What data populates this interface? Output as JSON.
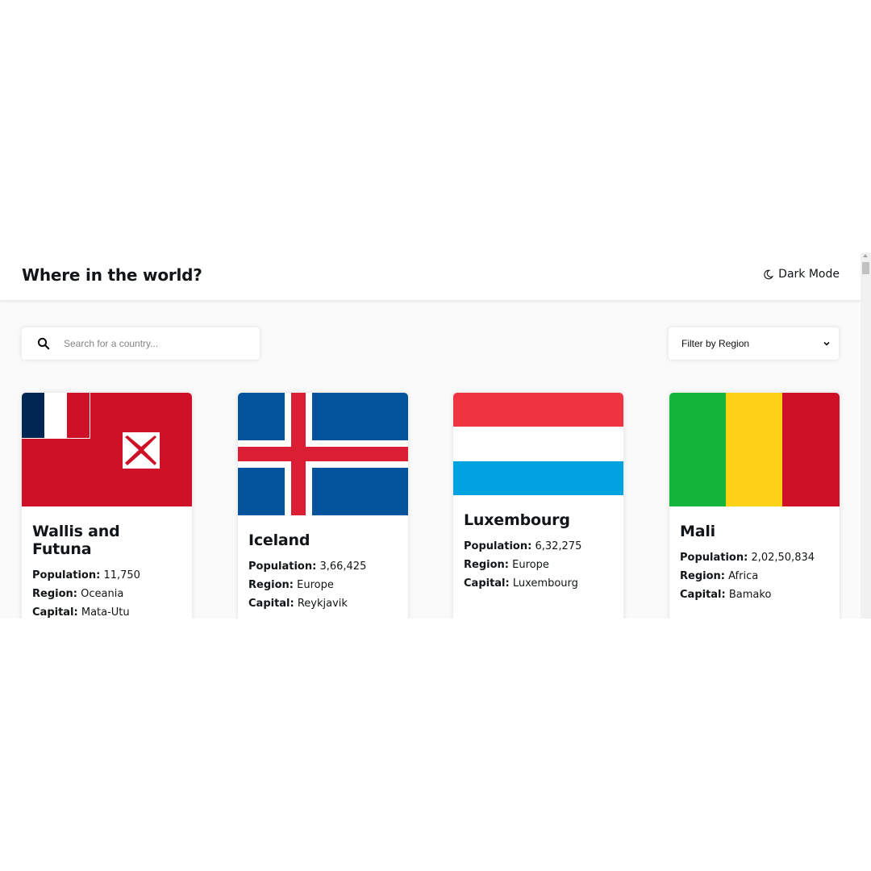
{
  "header": {
    "title": "Where in the world?",
    "dark_mode_label": "Dark Mode",
    "dark_mode_icon": "moon-icon"
  },
  "search": {
    "placeholder": "Search for a country...",
    "value": "",
    "icon": "search-icon"
  },
  "filter": {
    "label": "Filter by Region",
    "icon": "chevron-down-icon"
  },
  "labels": {
    "population": "Population:",
    "region": "Region:",
    "capital": "Capital:"
  },
  "countries": [
    {
      "name": "Wallis and Futuna",
      "population": "11,750",
      "region": "Oceania",
      "capital": "Mata-Utu",
      "flag": {
        "colors": [
          "#CE1126",
          "#002654",
          "#FFFFFF"
        ]
      }
    },
    {
      "name": "Iceland",
      "population": "3,66,425",
      "region": "Europe",
      "capital": "Reykjavik",
      "flag": {
        "colors": [
          "#02529C",
          "#FFFFFF",
          "#DC1E35"
        ]
      }
    },
    {
      "name": "Luxembourg",
      "population": "6,32,275",
      "region": "Europe",
      "capital": "Luxembourg",
      "flag": {
        "colors": [
          "#EF3340",
          "#FFFFFF",
          "#00A3E0"
        ]
      }
    },
    {
      "name": "Mali",
      "population": "2,02,50,834",
      "region": "Africa",
      "capital": "Bamako",
      "flag": {
        "colors": [
          "#14B53A",
          "#FCD116",
          "#CE1126"
        ]
      }
    }
  ]
}
